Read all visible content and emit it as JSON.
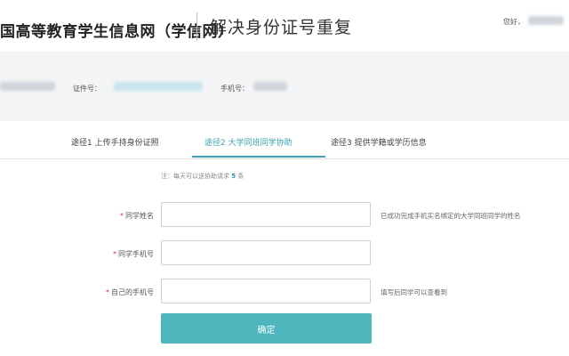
{
  "header": {
    "site_name": "国高等教育学生信息网（学信网）",
    "page_title": "解决身份证号重复",
    "greeting": "您好，"
  },
  "info": {
    "id_label": "证件号：",
    "phone_label": "手机号："
  },
  "tabs": [
    {
      "label": "途径1 上传手持身份证照",
      "active": false
    },
    {
      "label": "途径2 大学同班同学协助",
      "active": true
    },
    {
      "label": "途径3 提供学籍或学历信息",
      "active": false
    }
  ],
  "notice": {
    "prefix": "注：每天可以送协助请求",
    "count": "5",
    "suffix": "条"
  },
  "form": {
    "fields": [
      {
        "label": "同学姓名",
        "required_mark": "*",
        "value": "",
        "hint": "已成功完成手机实名绑定的大学同班同学的姓名"
      },
      {
        "label": "同学手机号",
        "required_mark": "*",
        "value": "",
        "hint": ""
      },
      {
        "label": "自己的手机号",
        "required_mark": "*",
        "value": "",
        "hint": "填写后同学可以查看到"
      }
    ],
    "submit_label": "确定"
  },
  "colors": {
    "accent": "#3aa3b3",
    "button": "#4eb7bd",
    "band": "#f3f4f5"
  }
}
